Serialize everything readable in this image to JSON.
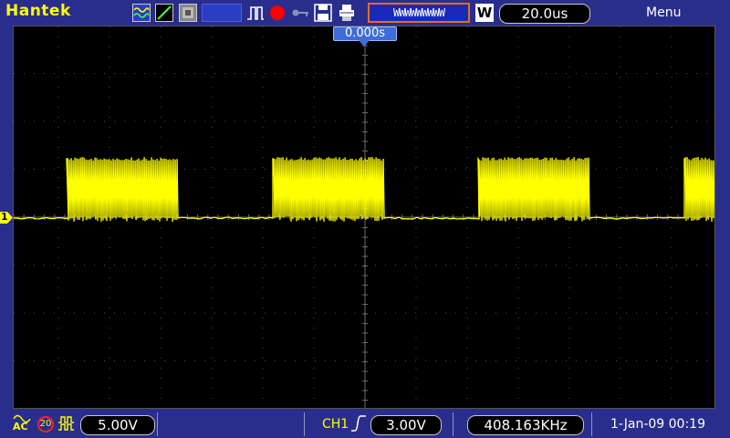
{
  "header": {
    "brand": "Hantek",
    "wave_mode": "WWWWWWWWW",
    "wave_mode_badge": "W",
    "timebase": "20.0us",
    "menu_label": "Menu",
    "icons": [
      "wave-display-icon",
      "cursor-line-icon",
      "persist-icon",
      "empty-slot",
      "pulse-icon",
      "record-icon",
      "key-icon",
      "save-icon",
      "print-icon"
    ]
  },
  "screen": {
    "trigger_time_label": "0.000s",
    "ch1_marker": "1",
    "grid_divisions": {
      "x": 14,
      "y": 8
    }
  },
  "footer": {
    "coupling": "AC",
    "bandwidth_limit": "20",
    "ch1_volts_div": "5.00V",
    "trigger_source": "CH1",
    "trigger_level": "3.00V",
    "frequency": "408.163KHz",
    "date_time": "1-Jan-09 00:19"
  },
  "colors": {
    "background": "#292e8c",
    "trace": "#ffff00",
    "grid": "#505050",
    "marker": "#3f6cd8"
  }
}
